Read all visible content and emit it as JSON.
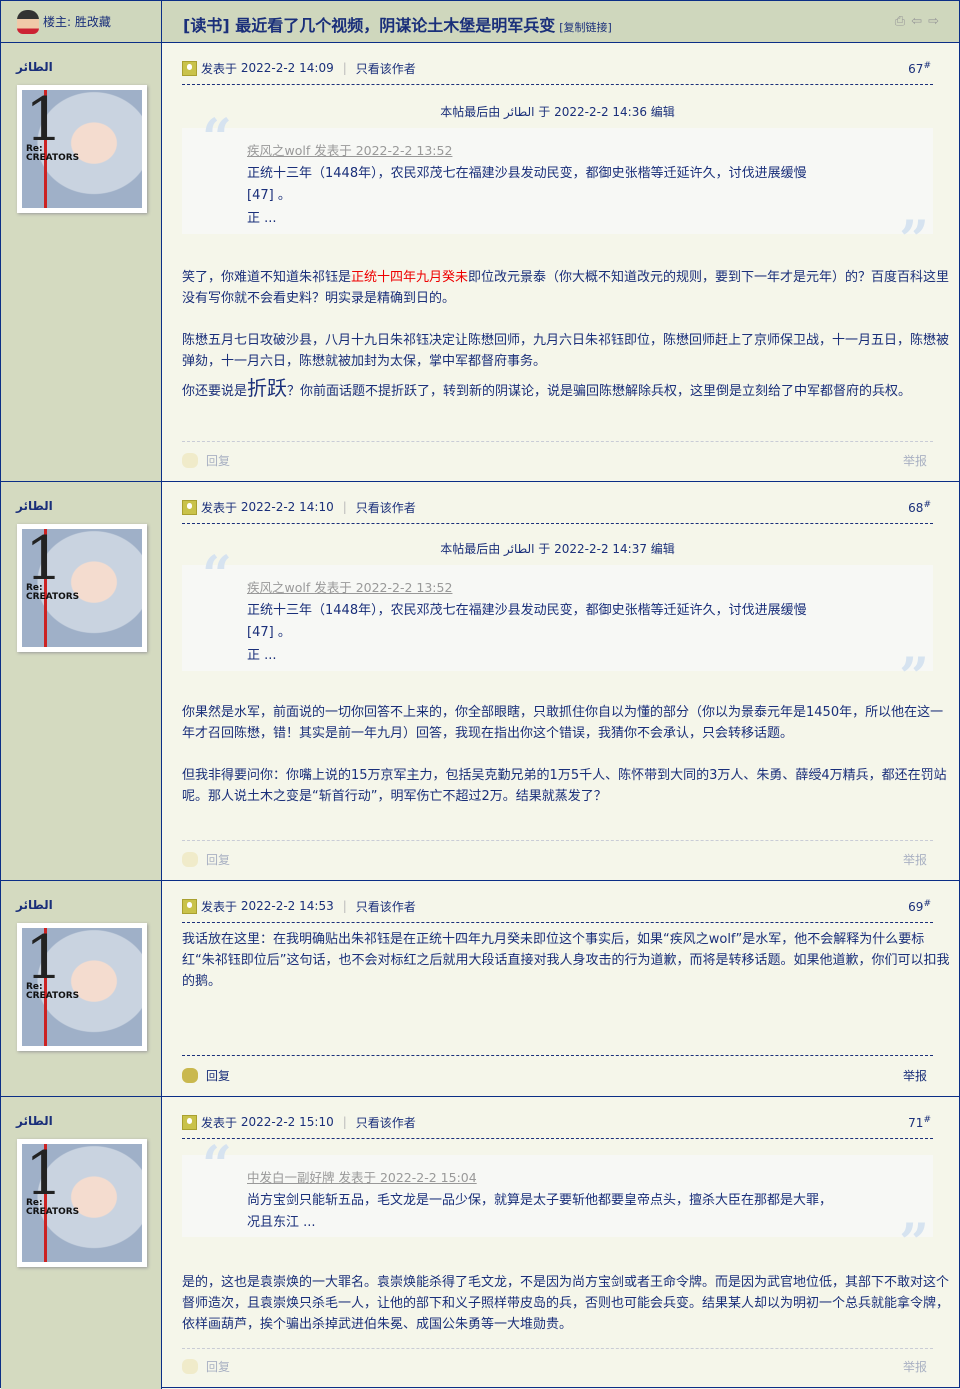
{
  "header": {
    "owner_label": "楼主: 胜改藏",
    "title": "[读书] 最近看了几个视频，阴谋论土木堡是明军兵变",
    "copy_link": "[复制链接]",
    "icons": [
      "print-icon",
      "prev-icon",
      "next-icon"
    ]
  },
  "common": {
    "username": "الطائر",
    "avatar_logo": "Re: CREATORS",
    "posted_prefix": "发表于",
    "only_author": "只看该作者",
    "reply": "回复",
    "report": "举报"
  },
  "posts": [
    {
      "time": "2022-2-2 14:09",
      "floor": "67",
      "edit_note": "本帖最后由 الطائر 于 2022-2-2 14:36 编辑",
      "quote": {
        "head": "疾风之wolf 发表于 2022-2-2 13:52",
        "lines": [
          "正统十三年（1448年），农民邓茂七在福建沙县发动民变，都御史张楷等迁延许久，讨伐进展缓慢",
          "[47] 。",
          "正 ..."
        ]
      },
      "p1_a": "笑了，你难道不知道朱祁钰是",
      "p1_red": "正统十四年九月癸未",
      "p1_b": "即位改元景泰（你大概不知道改元的规则，要到下一年才是元年）的？百度百科这里没有写你就不会看史料？明实录是精确到日的。",
      "p2": "陈懋五月七日攻破沙县，八月十九日朱祁钰决定让陈懋回师，九月六日朱祁钰即位，陈懋回师赶上了京师保卫战，十一月五日，陈懋被弹劾，十一月六日，陈懋就被加封为太保，掌中军都督府事务。",
      "p3_a": "你还要说是",
      "p3_big": "折跃",
      "p3_b": "？你前面话题不提折跃了，转到新的阴谋论，说是骗回陈懋解除兵权，这里倒是立刻给了中军都督府的兵权。"
    },
    {
      "time": "2022-2-2 14:10",
      "floor": "68",
      "edit_note": "本帖最后由 الطائر 于 2022-2-2 14:37 编辑",
      "quote": {
        "head": "疾风之wolf 发表于 2022-2-2 13:52",
        "lines": [
          "正统十三年（1448年），农民邓茂七在福建沙县发动民变，都御史张楷等迁延许久，讨伐进展缓慢",
          "[47] 。",
          "正 ..."
        ]
      },
      "p1": "你果然是水军，前面说的一切你回答不上来的，你全部眼瞎，只敢抓住你自以为懂的部分（你以为景泰元年是1450年，所以他在这一年才召回陈懋，错！其实是前一年九月）回答，我现在指出你这个错误，我猜你不会承认，只会转移话题。",
      "p2": "但我非得要问你：你嘴上说的15万京军主力，包括吴克勤兄弟的1万5千人、陈怀带到大同的3万人、朱勇、薛绶4万精兵，都还在罚站呢。那人说土木之变是“斩首行动”，明军伤亡不超过2万。结果就蒸发了？"
    },
    {
      "time": "2022-2-2 14:53",
      "floor": "69",
      "p1": "我话放在这里：在我明确贴出朱祁钰是在正统十四年九月癸未即位这个事实后，如果“疾风之wolf”是水军，他不会解释为什么要标红“朱祁钰即位后”这句话，也不会对标红之后就用大段话直接对我人身攻击的行为道歉，而将是转移话题。如果他道歉，你们可以扣我的鹅。"
    },
    {
      "time": "2022-2-2 15:10",
      "floor": "71",
      "quote": {
        "head": "中发白一副好牌 发表于 2022-2-2 15:04",
        "lines": [
          "尚方宝剑只能斩五品，毛文龙是一品少保，就算是太子要斩他都要皇帝点头，擅杀大臣在那都是大罪，",
          "况且东江 ..."
        ]
      },
      "p1": "是的，这也是袁崇焕的一大罪名。袁崇焕能杀得了毛文龙，不是因为尚方宝剑或者王命令牌。而是因为武官地位低，其部下不敢对这个督师造次，且袁崇焕只杀毛一人，让他的部下和义子照样带皮岛的兵，否则也可能会兵变。结果某人却以为明初一个总兵就能拿令牌，依样画葫芦，挨个骗出杀掉武进伯朱冕、成国公朱勇等一大堆勋贵。"
    }
  ]
}
